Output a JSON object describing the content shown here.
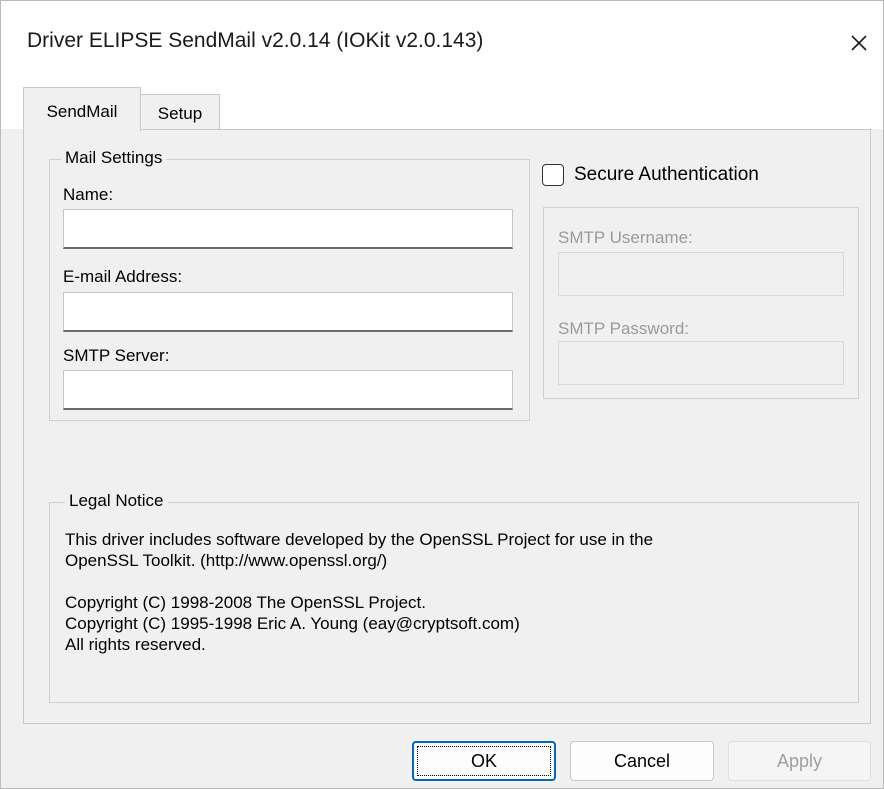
{
  "window": {
    "title": "Driver ELIPSE SendMail v2.0.14 (IOKit v2.0.143)",
    "close_glyph": "✕"
  },
  "tabs": [
    {
      "label": "SendMail",
      "active": true
    },
    {
      "label": "Setup",
      "active": false
    }
  ],
  "mail_settings": {
    "group_title": "Mail Settings",
    "name_label": "Name:",
    "name_value": "",
    "email_label": "E-mail Address:",
    "email_value": "",
    "smtp_server_label": "SMTP Server:",
    "smtp_server_value": ""
  },
  "secure_auth": {
    "checkbox_label": "Secure Authentication",
    "checked": false,
    "username_label": "SMTP Username:",
    "username_value": "",
    "password_label": "SMTP Password:",
    "password_value": ""
  },
  "legal_notice": {
    "group_title": "Legal Notice",
    "lines": [
      "This driver includes software developed by the OpenSSL Project for use in the",
      "OpenSSL Toolkit. (http://www.openssl.org/)",
      "",
      "Copyright (C) 1998-2008 The OpenSSL Project.",
      "Copyright (C) 1995-1998 Eric A. Young (eay@cryptsoft.com)",
      "All rights reserved."
    ]
  },
  "buttons": {
    "ok_label": "OK",
    "cancel_label": "Cancel",
    "apply_label": "Apply"
  },
  "colors": {
    "accent": "#0067c0",
    "disabled_text": "#9a9a9a"
  }
}
